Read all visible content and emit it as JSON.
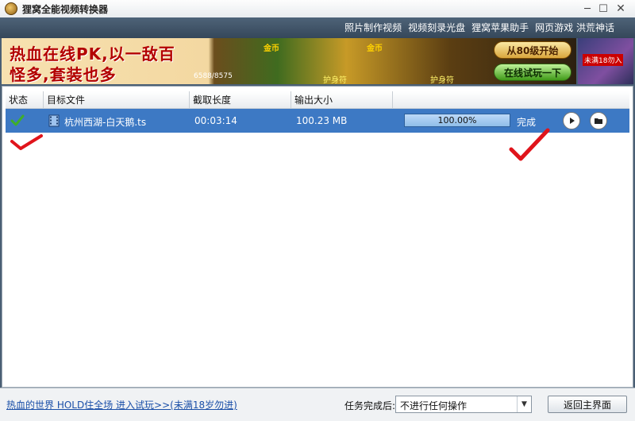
{
  "window": {
    "title": "狸窝全能视频转换器",
    "minimize_glyph": "─",
    "maximize_glyph": "☐",
    "close_glyph": "✕"
  },
  "menu": {
    "items": [
      "照片制作视频",
      "视频刻录光盘",
      "狸窝苹果助手",
      "网页游戏 洪荒神话"
    ]
  },
  "banner": {
    "line1": "热血在线PK,以一敌百",
    "line2": "怪多,套装也多",
    "counter": "6588/8575",
    "coin_label": "金币",
    "amulet_label": "护身符",
    "btn_start": "从80级开始",
    "btn_try": "在线试玩一下",
    "side_tag": "未满18勿入"
  },
  "table": {
    "columns": [
      "状态",
      "目标文件",
      "截取长度",
      "输出大小",
      ""
    ],
    "rows": [
      {
        "file": "杭州西湖-白天鹅.ts",
        "length": "00:03:14",
        "size": "100.23 MB",
        "progress": 1.0,
        "progress_text": "100.00%",
        "state": "完成"
      }
    ]
  },
  "footer": {
    "ad_link": "热血的世界 HOLD住全场 进入试玩>>(未满18岁勿进)",
    "after_label": "任务完成后:",
    "after_value": "不进行任何操作",
    "back_button": "返回主界面"
  },
  "colors": {
    "row_selected": "#3d79c4",
    "annotation_red": "#e0141b",
    "check_green": "#3fae2a"
  }
}
